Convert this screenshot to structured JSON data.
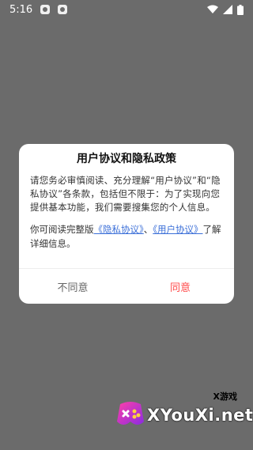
{
  "status_bar": {
    "time": "5:16"
  },
  "dialog": {
    "title": "用户协议和隐私政策",
    "body": "请您务必审慎阅读、充分理解“用户协议”和“隐私协议”各条款，包括但不限于：为了实现向您提供基本功能，我们需要搜集您的个人信息。",
    "link_prefix": "你可阅读完整版",
    "privacy_link": "《隐私协议》",
    "separator": "、",
    "user_link": "《用户协议》",
    "link_suffix": "了解详细信息。",
    "disagree": "不同意",
    "agree": "同意"
  },
  "watermark": {
    "brand_small": "X游戏",
    "brand_main": "XYouXi.net"
  },
  "colors": {
    "overlay": "#6b6b6b",
    "link": "#3b6fd8",
    "agree": "#ff4a4a",
    "disagree": "#666666"
  }
}
